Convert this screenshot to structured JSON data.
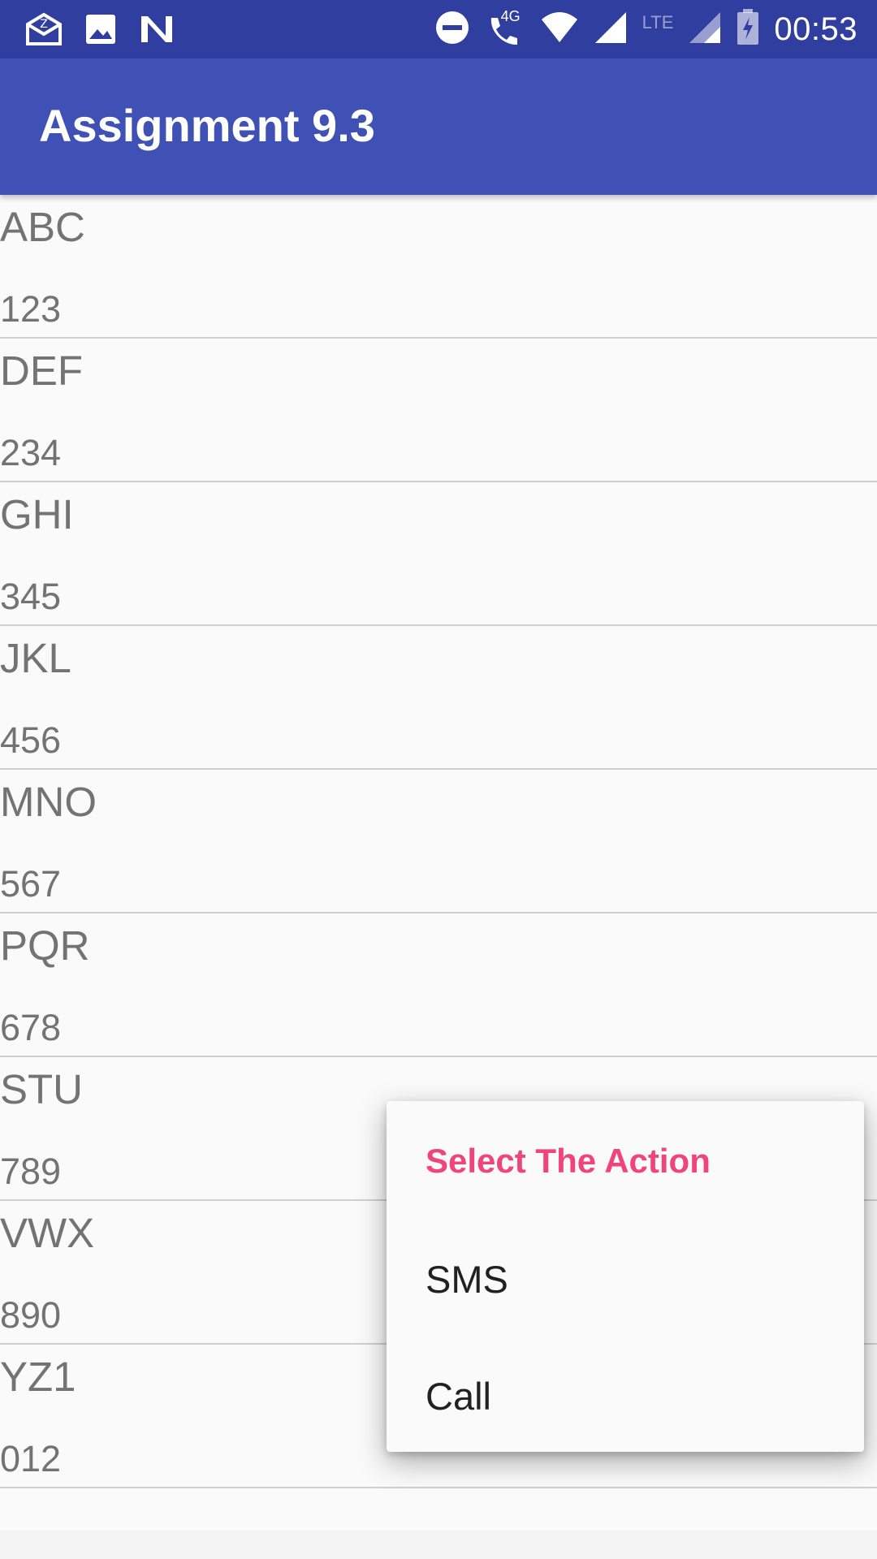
{
  "status_bar": {
    "time": "00:53",
    "network_4g": "4G",
    "network_lte": "LTE",
    "left_icons": [
      "mail-icon",
      "image-icon",
      "n-icon"
    ],
    "right_icons": [
      "dnd-icon",
      "wifi-call-icon",
      "wifi-icon",
      "signal-icon",
      "signal-icon",
      "battery-icon"
    ]
  },
  "app_bar": {
    "title": "Assignment 9.3"
  },
  "contacts": [
    {
      "name": "ABC",
      "number": "123"
    },
    {
      "name": "DEF",
      "number": "234"
    },
    {
      "name": "GHI",
      "number": "345"
    },
    {
      "name": "JKL",
      "number": "456"
    },
    {
      "name": "MNO",
      "number": "567"
    },
    {
      "name": "PQR",
      "number": "678"
    },
    {
      "name": "STU",
      "number": "789"
    },
    {
      "name": "VWX",
      "number": "890"
    },
    {
      "name": "YZ1",
      "number": "012"
    }
  ],
  "context_menu": {
    "title": "Select The Action",
    "items": [
      {
        "label": "SMS"
      },
      {
        "label": "Call"
      }
    ]
  },
  "colors": {
    "status_bar": "#303f9f",
    "app_bar": "#3f51b5",
    "menu_title": "#f0457c"
  }
}
